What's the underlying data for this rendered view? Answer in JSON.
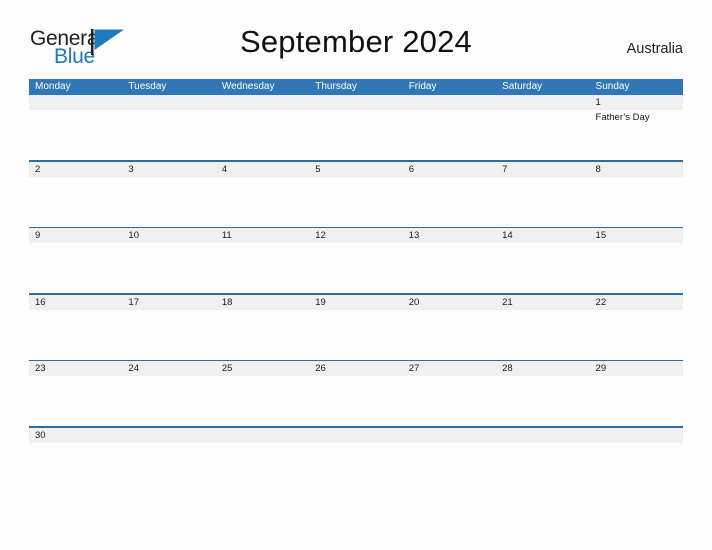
{
  "logo": {
    "text_primary": "General",
    "text_secondary": "Blue",
    "flag_icon": "triangle-flag-icon",
    "color_primary": "#231f20",
    "color_secondary": "#1c7ac0"
  },
  "header": {
    "title": "September 2024",
    "country": "Australia"
  },
  "colors": {
    "header_blue": "#3077b8",
    "rule_blue": "#2e6da4",
    "date_band_gray": "#f0f0f0",
    "page_background": "#fdfdfd",
    "text": "#1a1a1a"
  },
  "calendar": {
    "weekdays": [
      "Monday",
      "Tuesday",
      "Wednesday",
      "Thursday",
      "Friday",
      "Saturday",
      "Sunday"
    ],
    "weeks": [
      [
        {
          "date": "",
          "events": []
        },
        {
          "date": "",
          "events": []
        },
        {
          "date": "",
          "events": []
        },
        {
          "date": "",
          "events": []
        },
        {
          "date": "",
          "events": []
        },
        {
          "date": "",
          "events": []
        },
        {
          "date": "1",
          "events": [
            "Father’s Day"
          ]
        }
      ],
      [
        {
          "date": "2",
          "events": []
        },
        {
          "date": "3",
          "events": []
        },
        {
          "date": "4",
          "events": []
        },
        {
          "date": "5",
          "events": []
        },
        {
          "date": "6",
          "events": []
        },
        {
          "date": "7",
          "events": []
        },
        {
          "date": "8",
          "events": []
        }
      ],
      [
        {
          "date": "9",
          "events": []
        },
        {
          "date": "10",
          "events": []
        },
        {
          "date": "11",
          "events": []
        },
        {
          "date": "12",
          "events": []
        },
        {
          "date": "13",
          "events": []
        },
        {
          "date": "14",
          "events": []
        },
        {
          "date": "15",
          "events": []
        }
      ],
      [
        {
          "date": "16",
          "events": []
        },
        {
          "date": "17",
          "events": []
        },
        {
          "date": "18",
          "events": []
        },
        {
          "date": "19",
          "events": []
        },
        {
          "date": "20",
          "events": []
        },
        {
          "date": "21",
          "events": []
        },
        {
          "date": "22",
          "events": []
        }
      ],
      [
        {
          "date": "23",
          "events": []
        },
        {
          "date": "24",
          "events": []
        },
        {
          "date": "25",
          "events": []
        },
        {
          "date": "26",
          "events": []
        },
        {
          "date": "27",
          "events": []
        },
        {
          "date": "28",
          "events": []
        },
        {
          "date": "29",
          "events": []
        }
      ],
      [
        {
          "date": "30",
          "events": []
        },
        {
          "date": "",
          "events": []
        },
        {
          "date": "",
          "events": []
        },
        {
          "date": "",
          "events": []
        },
        {
          "date": "",
          "events": []
        },
        {
          "date": "",
          "events": []
        },
        {
          "date": "",
          "events": []
        }
      ]
    ]
  }
}
